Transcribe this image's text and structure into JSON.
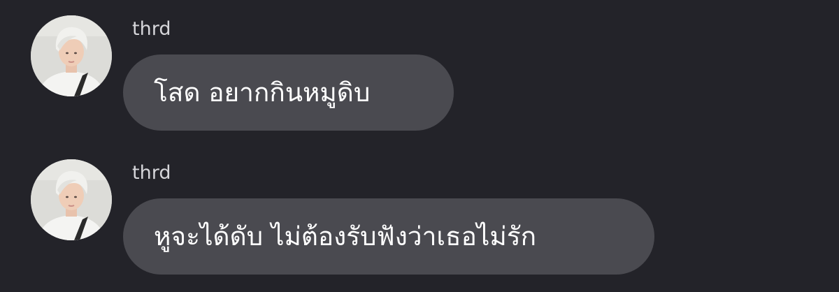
{
  "chat": {
    "messages": [
      {
        "sender": "thrd",
        "avatar_icon": "user-photo-avatar",
        "text": "โสด อยากกินหมูดิบ"
      },
      {
        "sender": "thrd",
        "avatar_icon": "user-photo-avatar",
        "text": "หูจะได้ดับ ไม่ต้องรับฟังว่าเธอไม่รัก"
      }
    ]
  },
  "colors": {
    "background": "#232329",
    "bubble": "#4a4a50",
    "sender_text": "#d6d6da",
    "message_text": "#ffffff"
  }
}
